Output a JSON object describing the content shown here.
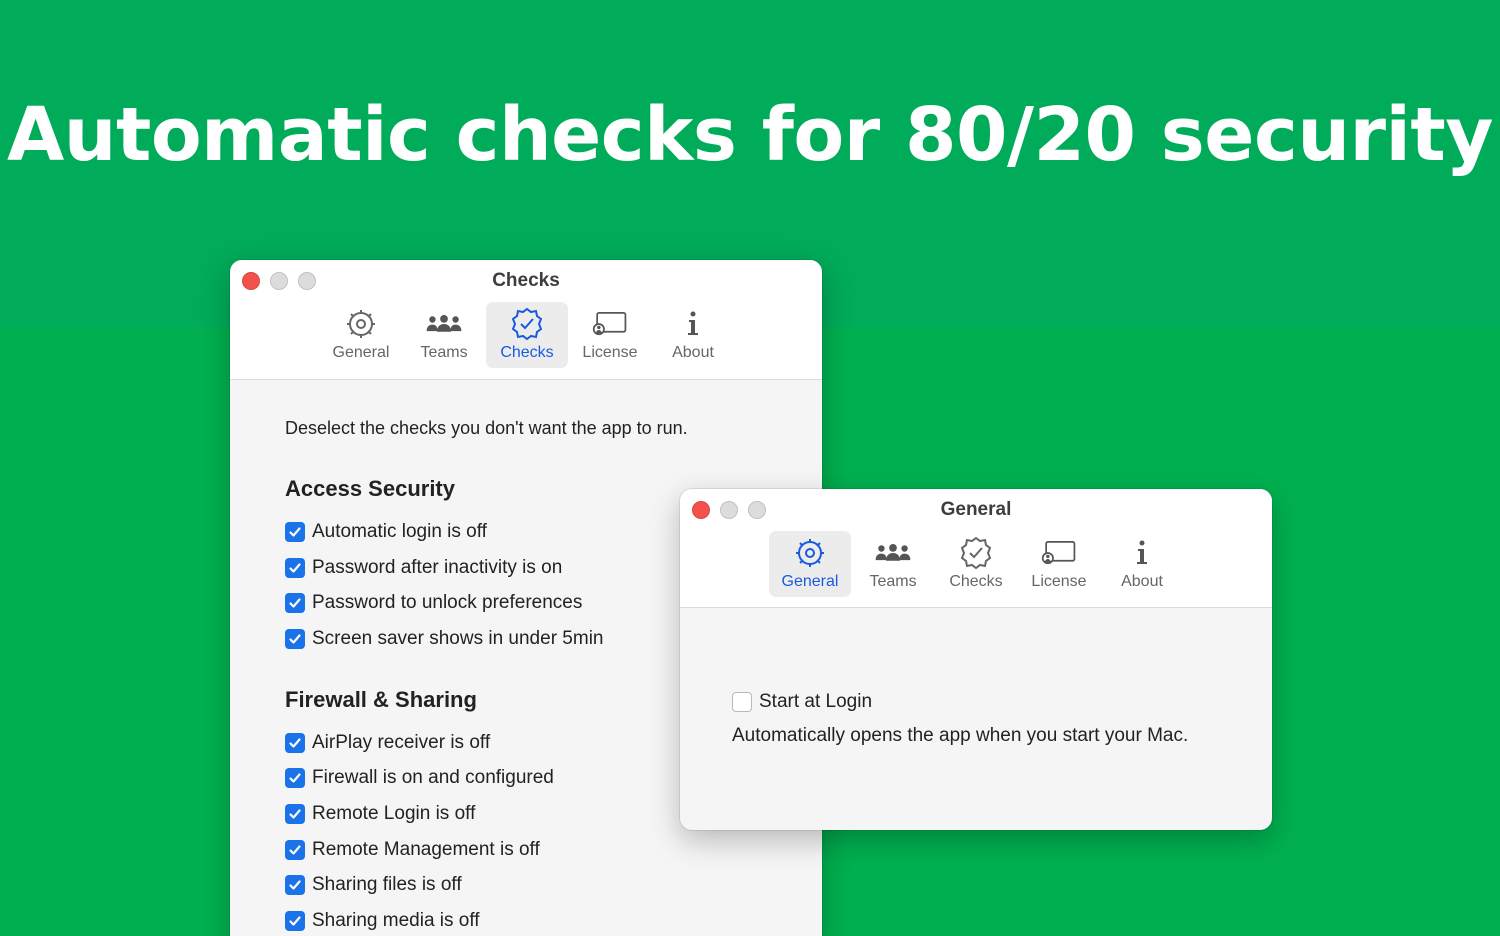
{
  "headline": "Automatic checks for 80/20 security",
  "checks_window": {
    "title": "Checks",
    "tabs": [
      {
        "label": "General",
        "icon": "gear-icon"
      },
      {
        "label": "Teams",
        "icon": "people-icon"
      },
      {
        "label": "Checks",
        "icon": "badge-check-icon"
      },
      {
        "label": "License",
        "icon": "license-icon"
      },
      {
        "label": "About",
        "icon": "info-icon"
      }
    ],
    "active_tab": "Checks",
    "intro": "Deselect the checks you don't want the app to run.",
    "sections": [
      {
        "title": "Access Security",
        "items": [
          {
            "label": "Automatic login is off",
            "checked": true
          },
          {
            "label": "Password after inactivity is on",
            "checked": true
          },
          {
            "label": "Password to unlock preferences",
            "checked": true
          },
          {
            "label": "Screen saver shows in under 5min",
            "checked": true
          }
        ]
      },
      {
        "title": "Firewall & Sharing",
        "items": [
          {
            "label": "AirPlay receiver is off",
            "checked": true
          },
          {
            "label": "Firewall is on and configured",
            "checked": true
          },
          {
            "label": "Remote Login is off",
            "checked": true
          },
          {
            "label": "Remote Management is off",
            "checked": true
          },
          {
            "label": "Sharing files is off",
            "checked": true
          },
          {
            "label": "Sharing media is off",
            "checked": true
          }
        ]
      }
    ]
  },
  "general_window": {
    "title": "General",
    "tabs": [
      {
        "label": "General",
        "icon": "gear-icon"
      },
      {
        "label": "Teams",
        "icon": "people-icon"
      },
      {
        "label": "Checks",
        "icon": "badge-check-icon"
      },
      {
        "label": "License",
        "icon": "license-icon"
      },
      {
        "label": "About",
        "icon": "info-icon"
      }
    ],
    "active_tab": "General",
    "start_at_login": {
      "label": "Start at Login",
      "checked": false
    },
    "description": "Automatically opens the app when you start your Mac."
  },
  "colors": {
    "background": "#00b050",
    "background_top": "#00ab59",
    "accent": "#1a73e8",
    "active_tab_text": "#1a5adf"
  }
}
